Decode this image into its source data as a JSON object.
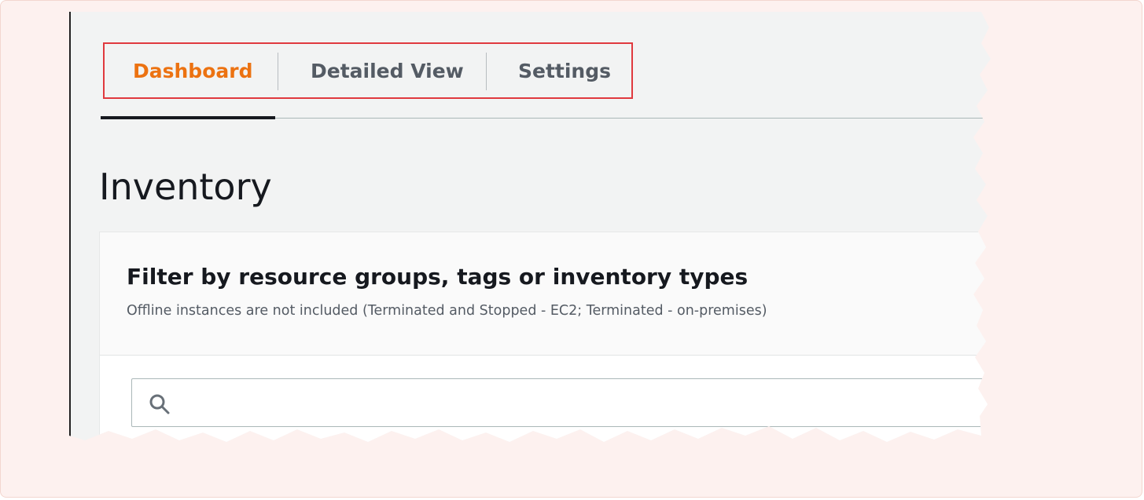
{
  "tabs": [
    {
      "label": "Dashboard",
      "active": true
    },
    {
      "label": "Detailed View",
      "active": false
    },
    {
      "label": "Settings",
      "active": false
    }
  ],
  "page": {
    "title": "Inventory"
  },
  "filter": {
    "title": "Filter by resource groups, tags or inventory types",
    "subtitle": "Offline instances are not included (Terminated and Stopped - EC2; Terminated - on-premises)",
    "search": {
      "value": "",
      "placeholder": "",
      "icon": "search-icon"
    }
  },
  "colors": {
    "active_tab": "#ec7211",
    "highlight_box": "#e0393e",
    "callout_bg": "#fdf1ef"
  }
}
